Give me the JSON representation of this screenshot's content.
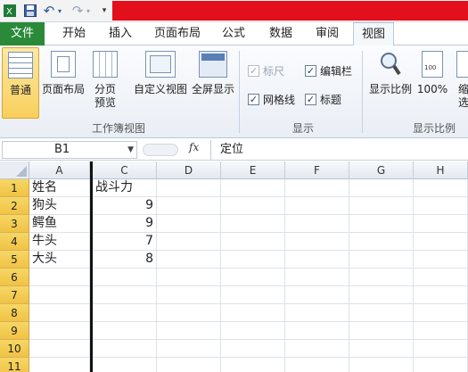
{
  "quick_access": {
    "undo_arrow": "↶",
    "redo_arrow": "↷"
  },
  "tabs": [
    "文件",
    "开始",
    "插入",
    "页面布局",
    "公式",
    "数据",
    "审阅",
    "视图"
  ],
  "active_tab": "视图",
  "ribbon": {
    "workbook_views": {
      "label": "工作簿视图",
      "buttons": [
        "普通",
        "页面布局",
        "分页\n预览",
        "自定义视图",
        "全屏显示"
      ]
    },
    "show": {
      "label": "显示",
      "ruler": "标尺",
      "formula_bar": "编辑栏",
      "gridlines": "网格线",
      "headings": "标题",
      "checked_mark": "✓"
    },
    "zoom": {
      "label": "显示比例",
      "zoom_button": "显示比例",
      "hundred_button": "100%",
      "zoom_to_selection_partial": "缩\n选定"
    }
  },
  "formula_bar": {
    "name_box": "B1",
    "fx": "fx",
    "value": "定位"
  },
  "columns": [
    "A",
    "C",
    "D",
    "E",
    "F",
    "G",
    "H"
  ],
  "rows": [
    "1",
    "2",
    "3",
    "4",
    "5",
    "6",
    "7",
    "8",
    "9",
    "10",
    "11"
  ],
  "cells": {
    "A1": "姓名",
    "C1": "战斗力",
    "A2": "狗头",
    "C2": "9",
    "A3": "鳄鱼",
    "C3": "9",
    "A4": "牛头",
    "C4": "7",
    "A5": "大头",
    "C5": "8"
  },
  "colors": {
    "file_tab": "#2a8a39",
    "title_bar_red": "#e30f1b",
    "row_header_highlight": "#f1c244"
  }
}
